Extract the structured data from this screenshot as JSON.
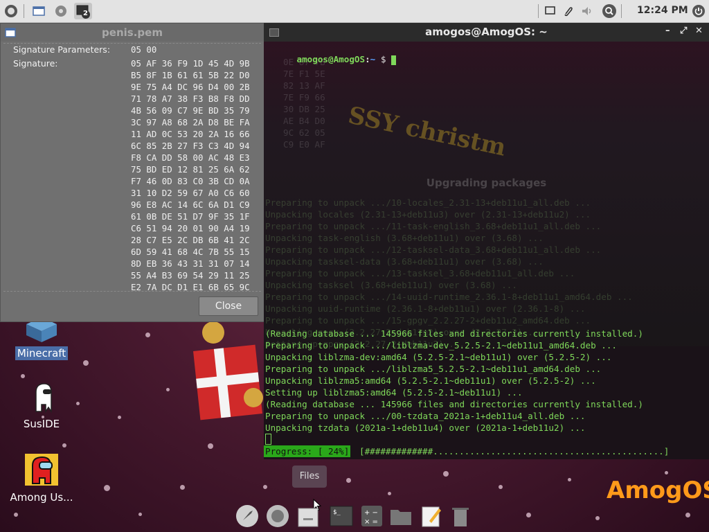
{
  "top_panel": {
    "workspace_badge": "2",
    "clock": "12:24 PM"
  },
  "cert_window": {
    "title": "penis.pem",
    "sig_params_label": "Signature Parameters:",
    "sig_params_value": "05 00",
    "signature_label": "Signature:",
    "signature_lines": [
      "05 AF 36 F9 1D 45 4D 9B",
      "B5 8F 1B 61 61 5B 22 D0",
      "9E 75 A4 DC 96 D4 00 2B",
      "71 78 A7 38 F3 B8 F8 DD",
      "4B 56 09 C7 9E BD 35 79",
      "3C 97 A8 68 2A D8 BE FA",
      "11 AD 0C 53 20 2A 16 66",
      "6C 85 2B 27 F3 C3 4D 94",
      "F8 CA DD 58 00 AC 48 E3",
      "75 BD ED 12 81 25 6A 62",
      "F7 46 0D 83 C0 3B CD 0A",
      "31 10 D2 59 67 A0 C6 60",
      "96 E8 AC 14 6C 6A D1 C9",
      "61 0B DE 51 D7 9F 35 1F",
      "C6 51 94 20 01 90 A4 19",
      "28 C7 E5 2C DB 6B 41 2C",
      "6D 59 41 68 4C 7B 55 15",
      "8D EB 36 43 31 31 07 14",
      "55 A4 B3 69 54 29 11 25",
      "E2 7A DC D1 E1 6B 65 9C"
    ],
    "close_label": "Close"
  },
  "terminal": {
    "title": "amogos@AmogOS: ~",
    "prompt_user": "amogos@AmogOS",
    "prompt_sep": ":",
    "prompt_path": "~",
    "prompt_symbol": " $ ",
    "ghost_hex": [
      "0E 87 7B",
      "7E F1 5E",
      "82 13 AF",
      "7E F9 66",
      "30 DB 25",
      "AE B4 D0",
      "9C 62 05",
      "C9 E0 AF"
    ],
    "ghost_heading": "Upgrading packages",
    "ghost_lines": [
      "Preparing to unpack .../10-locales_2.31-13+deb11u1_all.deb ...",
      "Unpacking locales (2.31-13+deb11u3) over (2.31-13+deb11u2) ...",
      "Preparing to unpack .../11-task-english_3.68+deb11u1_all.deb ...",
      "Unpacking task-english (3.68+deb11u1) over (3.68) ...",
      "Preparing to unpack .../12-tasksel-data_3.68+deb11u1_all.deb ...",
      "Unpacking tasksel-data (3.68+deb11u1) over (3.68) ...",
      "Preparing to unpack .../13-tasksel_3.68+deb11u1_all.deb ...",
      "Unpacking tasksel (3.68+deb11u1) over (3.68) ...",
      "Preparing to unpack .../14-uuid-runtime_2.36.1-8+deb11u1_amd64.deb ...",
      "Unpacking uuid-runtime (2.36.1-8+deb11u1) over (2.36.1-8) ...",
      "Preparing to unpack .../15-gpgv_2.2.27-2+deb11u2_amd64.deb ...",
      "Unpacking gpgv (2.2.27-2+deb11u2) over (2.2.27-2) ...",
      "Setting up gpgv (2.2.27-2+deb11u2) ..."
    ],
    "lines": [
      "(Reading database ... 145966 files and directories currently installed.)",
      "Preparing to unpack .../liblzma-dev_5.2.5-2.1~deb11u1_amd64.deb ...",
      "Unpacking liblzma-dev:amd64 (5.2.5-2.1~deb11u1) over (5.2.5-2) ...",
      "Preparing to unpack .../liblzma5_5.2.5-2.1~deb11u1_amd64.deb ...",
      "Unpacking liblzma5:amd64 (5.2.5-2.1~deb11u1) over (5.2.5-2) ...",
      "Setting up liblzma5:amd64 (5.2.5-2.1~deb11u1) ...",
      "(Reading database ... 145966 files and directories currently installed.)",
      "Preparing to unpack .../00-tzdata_2021a-1+deb11u4_all.deb ...",
      "Unpacking tzdata (2021a-1+deb11u4) over (2021a-1+deb11u2) ..."
    ],
    "progress_label": "Progress: [ 24%]",
    "progress_bar": "[#############............................................]",
    "progress_fraction": 0.24
  },
  "desktop": {
    "icons": [
      {
        "label": "Minecraft"
      },
      {
        "label": "SusIDE"
      },
      {
        "label": "Among Us..."
      }
    ],
    "logo_text": "AmogOS"
  },
  "dock": {
    "tooltip": "Files"
  },
  "colors": {
    "terminal_green": "#7fd85a",
    "path_blue": "#5aa0ff",
    "brand_orange": "#ff9a1a"
  }
}
